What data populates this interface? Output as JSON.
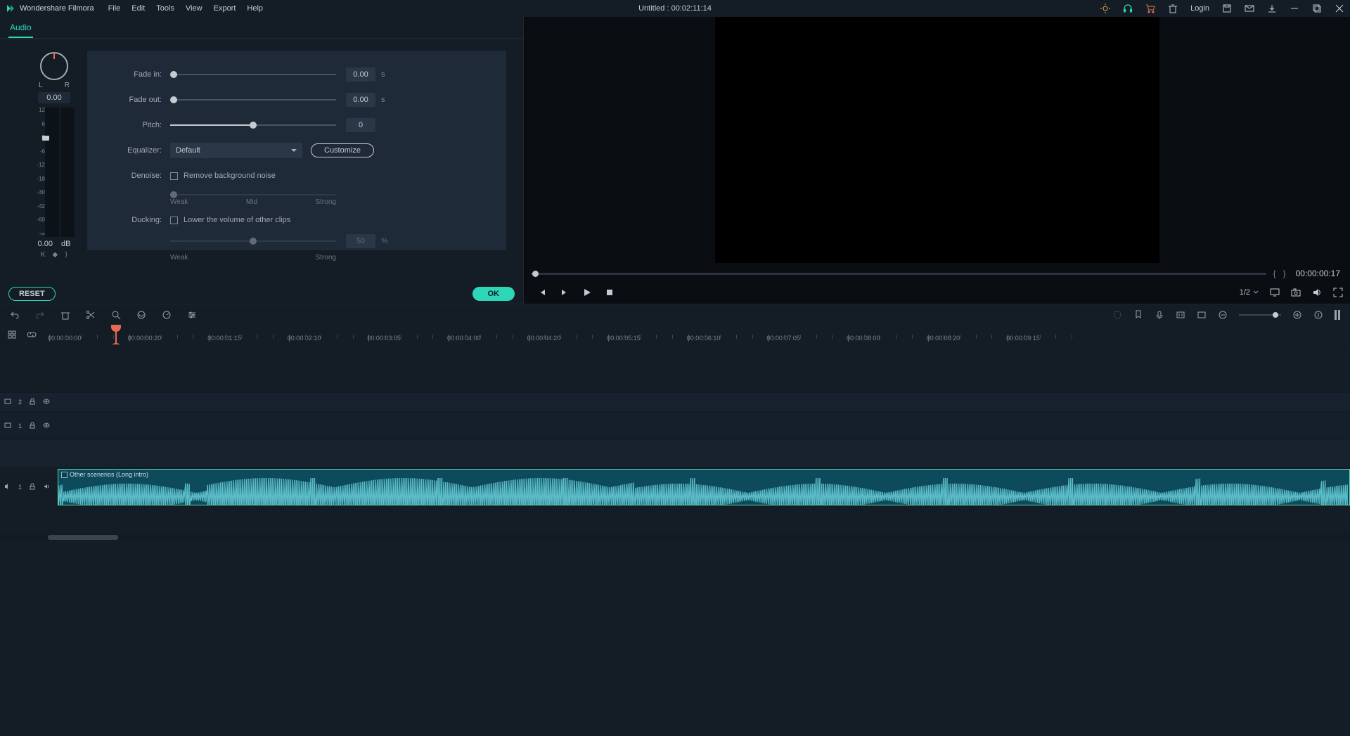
{
  "app": {
    "title": "Wondershare Filmora",
    "doc": "Untitled : 00:02:11:14",
    "login": "Login"
  },
  "menu": [
    "File",
    "Edit",
    "Tools",
    "View",
    "Export",
    "Help"
  ],
  "tab": "Audio",
  "knob": {
    "l": "L",
    "r": "R",
    "val": "0.00",
    "db": "0.00",
    "db_unit": "dB"
  },
  "vu_scale": [
    "12",
    "6",
    "0",
    "-6",
    "-12",
    "-18",
    "-30",
    "-42",
    "-60",
    "-∞"
  ],
  "props": {
    "fadein": {
      "label": "Fade in:",
      "val": "0.00",
      "unit": "s"
    },
    "fadeout": {
      "label": "Fade out:",
      "val": "0.00",
      "unit": "s"
    },
    "pitch": {
      "label": "Pitch:",
      "val": "0"
    },
    "equalizer": {
      "label": "Equalizer:",
      "val": "Default",
      "btn": "Customize"
    },
    "denoise": {
      "label": "Denoise:",
      "chk": "Remove background noise",
      "weak": "Weak",
      "mid": "Mid",
      "strong": "Strong"
    },
    "ducking": {
      "label": "Ducking:",
      "chk": "Lower the volume of other clips",
      "val": "50",
      "unit": "%",
      "weak": "Weak",
      "strong": "Strong"
    }
  },
  "buttons": {
    "reset": "RESET",
    "ok": "OK"
  },
  "preview": {
    "timecode": "00:00:00:17",
    "zoom": "1/2",
    "brace_l": "{",
    "brace_r": "}"
  },
  "ruler": [
    "00:00:00:00",
    "00:00:00:20",
    "00:00:01:15",
    "00:00:02:10",
    "00:00:03:05",
    "00:00:04:00",
    "00:00:04:20",
    "00:00:05:15",
    "00:00:06:10",
    "00:00:07:05",
    "00:00:08:00",
    "00:00:08:20",
    "00:00:09:15"
  ],
  "tracks": {
    "v2": "2",
    "v1": "1",
    "a1": "1",
    "clip": "Other scenerios  (Long intro)"
  }
}
